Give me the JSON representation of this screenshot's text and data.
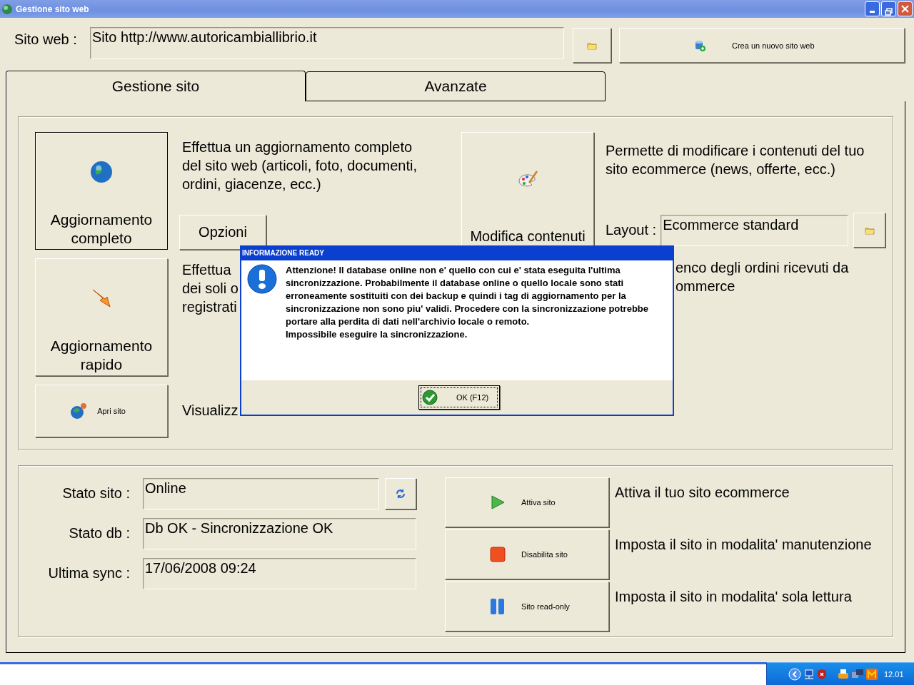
{
  "window": {
    "title": "Gestione sito web"
  },
  "site_bar": {
    "label": "Sito web :",
    "value": "Sito http://www.autoricambiallibrio.it",
    "new_site_button": "Crea un nuovo sito web"
  },
  "tabs": [
    {
      "label": "Gestione sito",
      "selected": true
    },
    {
      "label": "Avanzate",
      "selected": false
    }
  ],
  "full_update": {
    "button": "Aggiornamento completo",
    "description": "Effettua un aggiornamento completo del sito web (articoli, foto, documenti, ordini, giacenze, ecc.)",
    "options_button": "Opzioni"
  },
  "quick_update": {
    "button": "Aggiornamento rapido",
    "description_lines": [
      "Effettua",
      "dei soli o",
      "registrati"
    ]
  },
  "open_site": {
    "button": "Apri sito",
    "description": "Visualizz"
  },
  "edit_content": {
    "button": "Modifica contenuti",
    "description": "Permette di modificare i contenuti del tuo sito ecommerce (news, offerte, ecc.)",
    "layout_label": "Layout :",
    "layout_value": "Ecommerce standard"
  },
  "orders": {
    "description_lines": [
      "enco degli ordini ricevuti da",
      "ommerce"
    ]
  },
  "status_fields": [
    {
      "label": "Stato sito :",
      "value": "Online",
      "refresh": true
    },
    {
      "label": "Stato db :",
      "value": "Db OK - Sincronizzazione OK",
      "refresh": false
    },
    {
      "label": "Ultima sync :",
      "value": "17/06/2008 09:24",
      "refresh": false
    }
  ],
  "site_controls": [
    {
      "kind": "play",
      "button": "Attiva sito",
      "description": "Attiva il tuo sito ecommerce"
    },
    {
      "kind": "stop",
      "button": "Disabilita sito",
      "description": "Imposta il sito in modalita' manutenzione"
    },
    {
      "kind": "pause",
      "button": "Sito read-only",
      "description": "Imposta il sito in modalita' sola lettura"
    }
  ],
  "dialog": {
    "title": "INFORMAZIONE READY",
    "message": [
      "Attenzione! Il database online non e' quello con cui e' stata eseguita l'ultima sincronizzazione. Probabilmente il database online o quello locale sono stati erroneamente sostituiti con dei backup e quindi i tag di aggiornamento per la sincronizzazione non sono piu' validi. Procedere con la sincronizzazione potrebbe portare alla perdita di dati nell'archivio locale o remoto.",
      "Impossibile eseguire la sincronizzazione."
    ],
    "ok_button": "OK (F12)"
  },
  "taskbar": {
    "clock": "12.01"
  }
}
